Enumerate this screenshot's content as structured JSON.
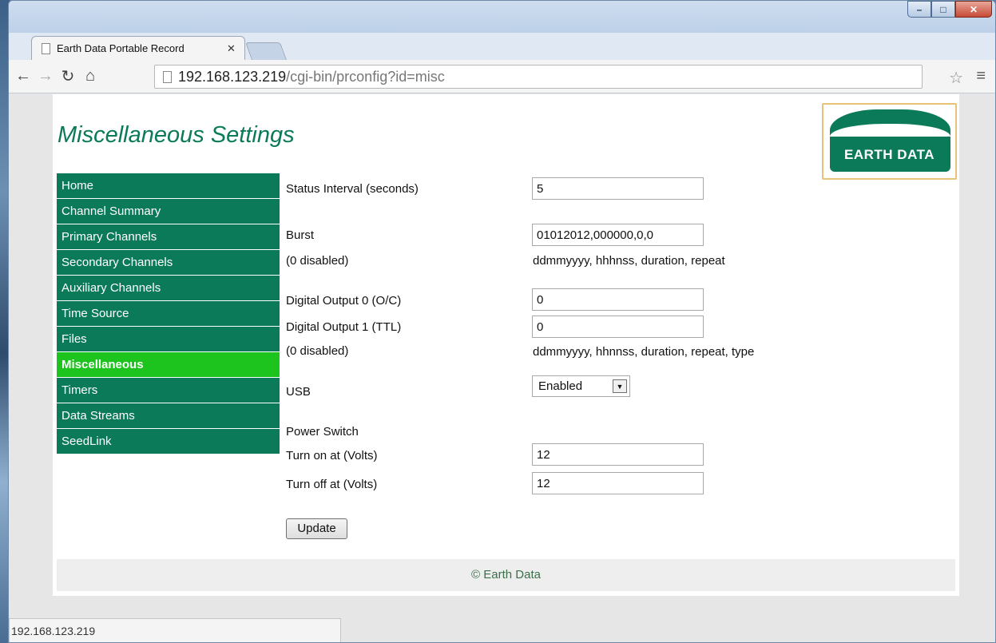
{
  "browser": {
    "tab_title": "Earth Data Portable Record",
    "url_host": "192.168.123.219",
    "url_path": "/cgi-bin/prconfig?id=misc",
    "status_text": "192.168.123.219"
  },
  "page": {
    "title": "Miscellaneous Settings",
    "logo_text": "EARTH DATA",
    "footer": "© Earth Data"
  },
  "nav": {
    "items": [
      {
        "label": "Home"
      },
      {
        "label": "Channel Summary"
      },
      {
        "label": "Primary Channels"
      },
      {
        "label": "Secondary Channels"
      },
      {
        "label": "Auxiliary Channels"
      },
      {
        "label": "Time Source"
      },
      {
        "label": "Files"
      },
      {
        "label": "Miscellaneous",
        "active": true
      },
      {
        "label": "Timers"
      },
      {
        "label": "Data Streams"
      },
      {
        "label": "SeedLink"
      }
    ]
  },
  "form": {
    "status_interval_label": "Status Interval (seconds)",
    "status_interval_value": "5",
    "burst_label": "Burst",
    "burst_value": "01012012,000000,0,0",
    "burst_note": "(0 disabled)",
    "burst_format": "ddmmyyyy, hhhnss, duration, repeat",
    "digital_out0_label": "Digital Output 0 (O/C)",
    "digital_out0_value": "0",
    "digital_out1_label": "Digital Output 1 (TTL)",
    "digital_out1_value": "0",
    "digital_note": "(0 disabled)",
    "digital_format": "ddmmyyyy, hhnnss, duration, repeat, type",
    "usb_label": "USB",
    "usb_value": "Enabled",
    "power_switch_label": "Power Switch",
    "turn_on_label": "Turn on at (Volts)",
    "turn_on_value": "12",
    "turn_off_label": "Turn off at (Volts)",
    "turn_off_value": "12",
    "update_button": "Update"
  },
  "colors": {
    "brand_green": "#0a7a58",
    "active_green": "#1ec41e",
    "logo_border": "#e9c27a"
  }
}
